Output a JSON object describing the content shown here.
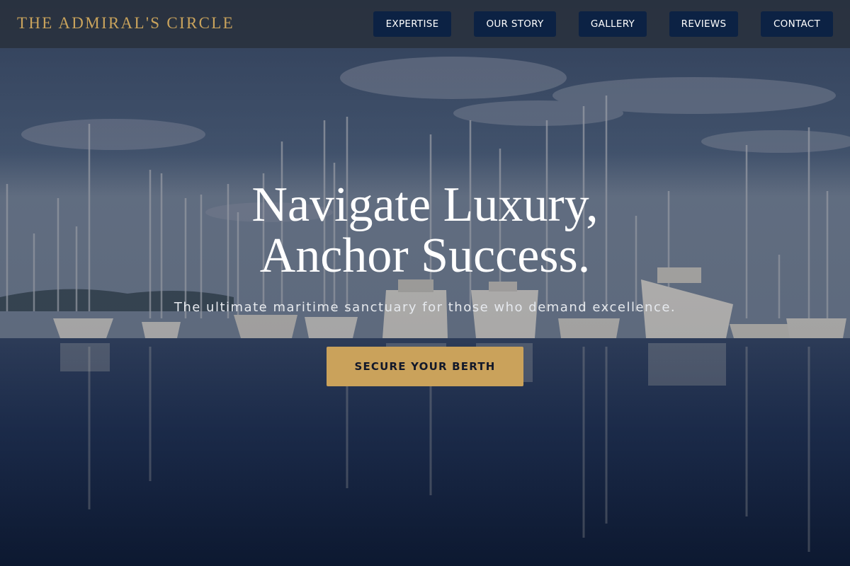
{
  "brand": {
    "name": "THE ADMIRAL'S CIRCLE"
  },
  "nav": {
    "items": [
      {
        "label": "EXPERTISE"
      },
      {
        "label": "OUR STORY"
      },
      {
        "label": "GALLERY"
      },
      {
        "label": "REVIEWS"
      },
      {
        "label": "CONTACT"
      }
    ]
  },
  "hero": {
    "headline_line1": "Navigate Luxury,",
    "headline_line2": "Anchor Success.",
    "tagline": "The ultimate maritime sanctuary for those who demand excellence.",
    "cta_label": "SECURE YOUR BERTH",
    "background": "marina-photo"
  },
  "colors": {
    "gold_accent": "#caa25b",
    "nav_button": "#0c2244",
    "header_bar": "#28303a"
  }
}
